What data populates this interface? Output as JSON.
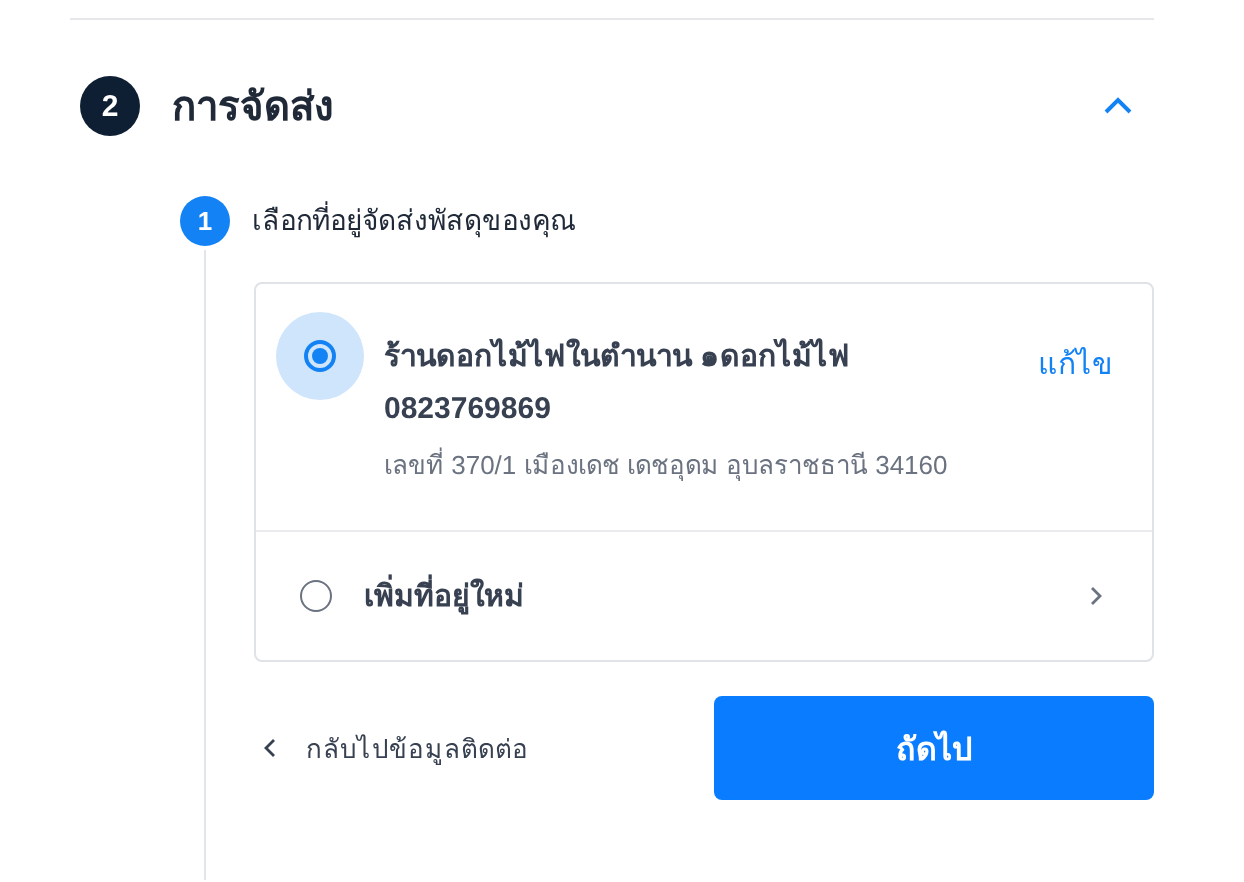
{
  "section": {
    "number": "2",
    "title": "การจัดส่ง",
    "expanded": true
  },
  "step": {
    "number": "1",
    "title": "เลือกที่อยู่จัดส่งพัสดุของคุณ"
  },
  "options": [
    {
      "kind": "address",
      "selected": true,
      "name": "ร้านดอกไม้ไฟในตำนาน ๑ดอกไม้ไฟ",
      "phone": "0823769869",
      "address": "เลขที่ 370/1 เมืองเดช เดชอุดม อุบลราชธานี 34160",
      "action": "แก้ไข"
    },
    {
      "kind": "add",
      "selected": false,
      "label": "เพิ่มที่อยู่ใหม่"
    }
  ],
  "back_link": "กลับไปข้อมูลติดต่อ",
  "next_button": "ถัดไป"
}
